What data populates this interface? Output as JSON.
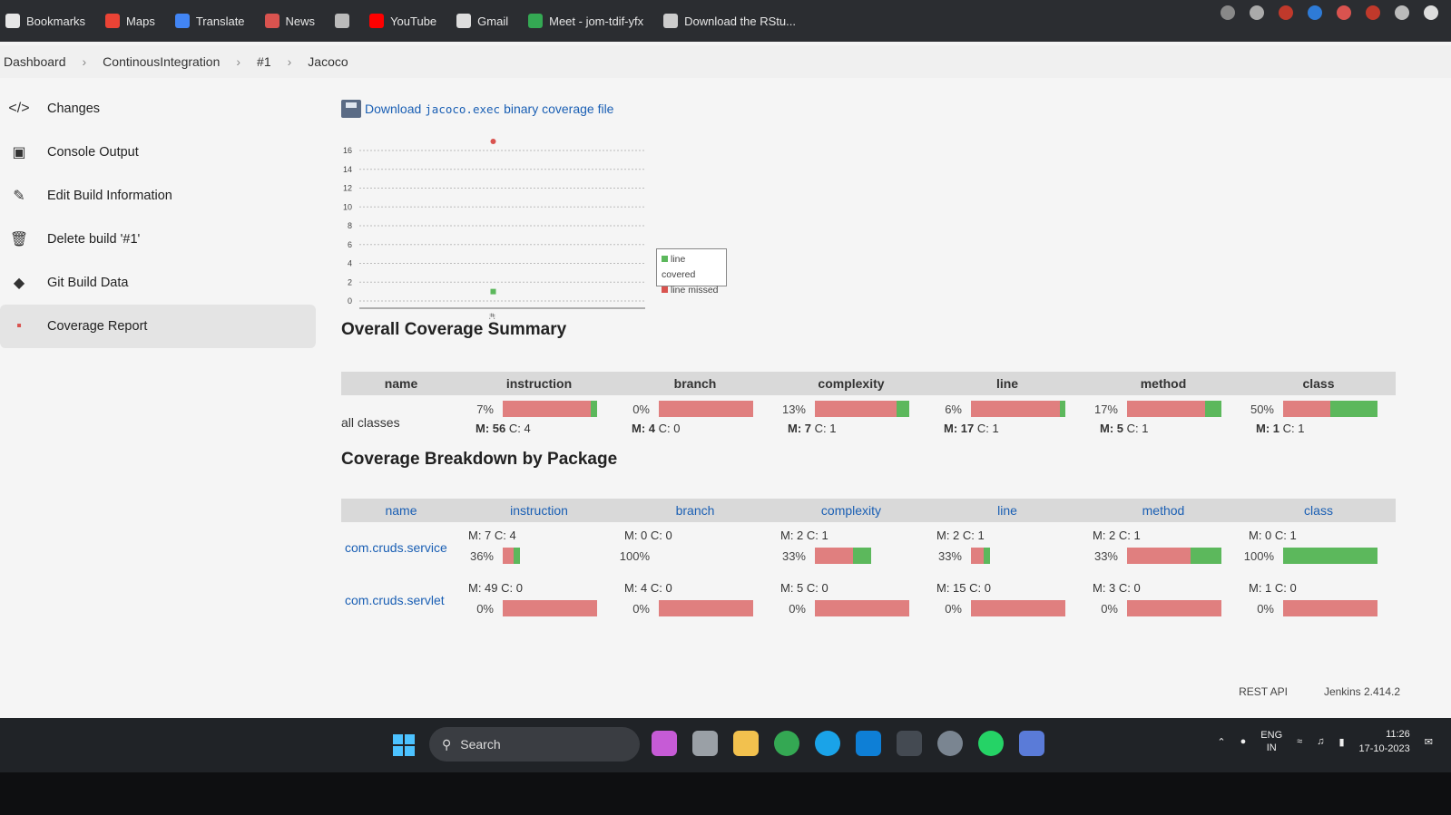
{
  "bookmarks": [
    {
      "label": "Bookmarks",
      "icon": "star-icon",
      "color": "#e6e6e6"
    },
    {
      "label": "Maps",
      "icon": "maps-icon",
      "color": "#ea4335"
    },
    {
      "label": "Translate",
      "icon": "translate-icon",
      "color": "#4285f4"
    },
    {
      "label": "News",
      "icon": "news-icon",
      "color": "#d9534f"
    },
    {
      "label": "",
      "icon": "globe-icon",
      "color": "#bbbbbb"
    },
    {
      "label": "YouTube",
      "icon": "youtube-icon",
      "color": "#ff0000"
    },
    {
      "label": "Gmail",
      "icon": "gmail-icon",
      "color": "#dddddd"
    },
    {
      "label": "Meet - jom-tdif-yfx",
      "icon": "meet-icon",
      "color": "#34a853"
    },
    {
      "label": "Download the RStu...",
      "icon": "page-icon",
      "color": "#cccccc"
    }
  ],
  "breadcrumb": [
    "Dashboard",
    "ContinousIntegration",
    "#1",
    "Jacoco"
  ],
  "sidebar": [
    {
      "label": "Changes",
      "icon": "code-icon"
    },
    {
      "label": "Console Output",
      "icon": "terminal-icon"
    },
    {
      "label": "Edit Build Information",
      "icon": "edit-icon"
    },
    {
      "label": "Delete build '#1'",
      "icon": "trash-icon"
    },
    {
      "label": "Git Build Data",
      "icon": "git-icon"
    },
    {
      "label": "Coverage Report",
      "icon": "coverage-report-icon",
      "active": true
    }
  ],
  "download": {
    "prefix": "Download",
    "code": "jacoco.exec",
    "suffix": "binary coverage file"
  },
  "chart_data": {
    "type": "scatter",
    "x": [
      "#1"
    ],
    "series": [
      {
        "name": "line covered",
        "values": [
          1
        ],
        "color": "#5cb85c"
      },
      {
        "name": "line missed",
        "values": [
          17
        ],
        "color": "#d9534f"
      }
    ],
    "yticks": [
      "0",
      "2",
      "4",
      "6",
      "8",
      "10",
      "12",
      "14",
      "16"
    ],
    "ylim": [
      0,
      16
    ],
    "xtick": "#1",
    "legend": "right"
  },
  "overall": {
    "title": "Overall Coverage Summary",
    "headers": [
      "name",
      "instruction",
      "branch",
      "complexity",
      "line",
      "method",
      "class"
    ],
    "row": {
      "name": "all classes",
      "cells": [
        {
          "pct": "7%",
          "missed": "M: 56",
          "covered": "C: 4",
          "covered_frac": 0.07
        },
        {
          "pct": "0%",
          "missed": "M: 4",
          "covered": "C: 0",
          "covered_frac": 0.0
        },
        {
          "pct": "13%",
          "missed": "M: 7",
          "covered": "C: 1",
          "covered_frac": 0.13
        },
        {
          "pct": "6%",
          "missed": "M: 17",
          "covered": "C: 1",
          "covered_frac": 0.06
        },
        {
          "pct": "17%",
          "missed": "M: 5",
          "covered": "C: 1",
          "covered_frac": 0.17
        },
        {
          "pct": "50%",
          "missed": "M: 1",
          "covered": "C: 1",
          "covered_frac": 0.5
        }
      ]
    }
  },
  "breakdown": {
    "title": "Coverage Breakdown by Package",
    "headers": [
      "name",
      "instruction",
      "branch",
      "complexity",
      "line",
      "method",
      "class"
    ],
    "rows": [
      {
        "name": "com.cruds.service",
        "cells": [
          {
            "pct": "36%",
            "missed": "M: 7",
            "covered": "C: 4",
            "covered_frac": 0.36,
            "total_frac": 0.18
          },
          {
            "pct": "100%",
            "missed": "M: 0",
            "covered": "C: 0",
            "covered_frac": 1.0,
            "total_frac": 0.0
          },
          {
            "pct": "33%",
            "missed": "M: 2",
            "covered": "C: 1",
            "covered_frac": 0.33,
            "total_frac": 0.6
          },
          {
            "pct": "33%",
            "missed": "M: 2",
            "covered": "C: 1",
            "covered_frac": 0.33,
            "total_frac": 0.2
          },
          {
            "pct": "33%",
            "missed": "M: 2",
            "covered": "C: 1",
            "covered_frac": 0.33,
            "total_frac": 1.0
          },
          {
            "pct": "100%",
            "missed": "M: 0",
            "covered": "C: 1",
            "covered_frac": 1.0,
            "total_frac": 1.0
          }
        ]
      },
      {
        "name": "com.cruds.servlet",
        "cells": [
          {
            "pct": "0%",
            "missed": "M: 49",
            "covered": "C: 0",
            "covered_frac": 0.0,
            "total_frac": 1.0
          },
          {
            "pct": "0%",
            "missed": "M: 4",
            "covered": "C: 0",
            "covered_frac": 0.0,
            "total_frac": 1.0
          },
          {
            "pct": "0%",
            "missed": "M: 5",
            "covered": "C: 0",
            "covered_frac": 0.0,
            "total_frac": 1.0
          },
          {
            "pct": "0%",
            "missed": "M: 15",
            "covered": "C: 0",
            "covered_frac": 0.0,
            "total_frac": 1.0
          },
          {
            "pct": "0%",
            "missed": "M: 3",
            "covered": "C: 0",
            "covered_frac": 0.0,
            "total_frac": 1.0
          },
          {
            "pct": "0%",
            "missed": "M: 1",
            "covered": "C: 0",
            "covered_frac": 0.0,
            "total_frac": 1.0
          }
        ]
      }
    ]
  },
  "footer": {
    "api": "REST API",
    "version": "Jenkins 2.414.2"
  },
  "taskbar": {
    "search": "Search",
    "lang_top": "ENG",
    "lang_bottom": "IN",
    "time": "11:26",
    "date": "17-10-2023"
  },
  "colors": {
    "missed": "#e07f7f",
    "covered": "#5cb85c",
    "link": "#1a5fb4"
  }
}
